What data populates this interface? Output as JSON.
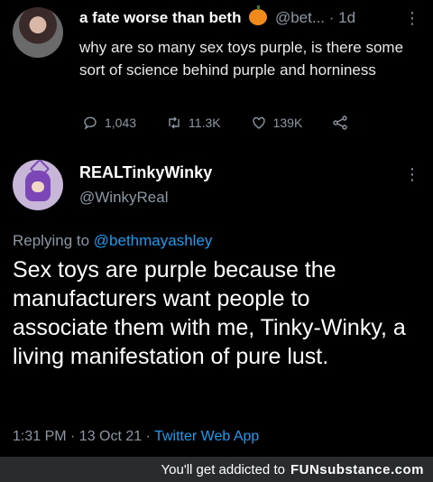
{
  "tweet1": {
    "author": "a fate worse than beth",
    "handle": "@bet...",
    "time": "· 1d",
    "more": "⋮",
    "text": "why are so many sex toys purple, is there some sort of science behind purple and horniness",
    "replies": "1,043",
    "retweets": "11.3K",
    "likes": "139K"
  },
  "tweet2": {
    "author": "REALTinkyWinky",
    "handle": "@WinkyReal",
    "more": "⋮",
    "replying_prefix": "Replying to",
    "replying_to": "@bethmayashley",
    "text": "Sex toys are purple because the manufacturers want people to associate them with me, Tinky-Winky, a living manifestation of pure lust.",
    "timestamp": "1:31 PM · 13 Oct 21 ·",
    "app": "Twitter Web App"
  },
  "footer": {
    "text": "You'll get addicted to",
    "brand": "FUNsubstance.com"
  },
  "colors": {
    "background": "#000000",
    "accent": "#1d9bf0",
    "muted": "#8b98a5",
    "footer_bg": "#2a2b2f"
  }
}
